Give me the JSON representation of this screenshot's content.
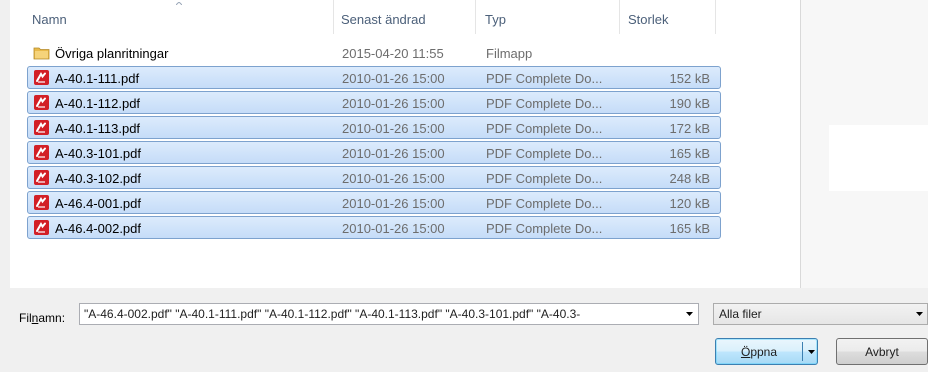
{
  "columns": {
    "name": "Namn",
    "modified": "Senast ändrad",
    "type": "Typ",
    "size": "Storlek"
  },
  "files": [
    {
      "icon": "folder-icon",
      "name": "Övriga planritningar",
      "modified": "2015-04-20 11:55",
      "type": "Filmapp",
      "size": "",
      "selected": false
    },
    {
      "icon": "pdf-icon",
      "name": "A-40.1-111.pdf",
      "modified": "2010-01-26 15:00",
      "type": "PDF Complete Do...",
      "size": "152 kB",
      "selected": true
    },
    {
      "icon": "pdf-icon",
      "name": "A-40.1-112.pdf",
      "modified": "2010-01-26 15:00",
      "type": "PDF Complete Do...",
      "size": "190 kB",
      "selected": true
    },
    {
      "icon": "pdf-icon",
      "name": "A-40.1-113.pdf",
      "modified": "2010-01-26 15:00",
      "type": "PDF Complete Do...",
      "size": "172 kB",
      "selected": true
    },
    {
      "icon": "pdf-icon",
      "name": "A-40.3-101.pdf",
      "modified": "2010-01-26 15:00",
      "type": "PDF Complete Do...",
      "size": "165 kB",
      "selected": true
    },
    {
      "icon": "pdf-icon",
      "name": "A-40.3-102.pdf",
      "modified": "2010-01-26 15:00",
      "type": "PDF Complete Do...",
      "size": "248 kB",
      "selected": true
    },
    {
      "icon": "pdf-icon",
      "name": "A-46.4-001.pdf",
      "modified": "2010-01-26 15:00",
      "type": "PDF Complete Do...",
      "size": "120 kB",
      "selected": true
    },
    {
      "icon": "pdf-icon",
      "name": "A-46.4-002.pdf",
      "modified": "2010-01-26 15:00",
      "type": "PDF Complete Do...",
      "size": "165 kB",
      "selected": true
    }
  ],
  "footer": {
    "filename_label_pre": "Fil",
    "filename_label_accel": "n",
    "filename_label_post": "amn:",
    "filename_value": "\"A-46.4-002.pdf\" \"A-40.1-111.pdf\" \"A-40.1-112.pdf\" \"A-40.1-113.pdf\" \"A-40.3-101.pdf\" \"A-40.3-",
    "filter_value": "Alla filer",
    "open_label_accel": "Ö",
    "open_label_rest": "ppna",
    "cancel_label": "Avbryt"
  },
  "colors": {
    "selection_fill": "#cfe3fb",
    "selection_border": "#7da2ce",
    "pdf_icon": "#d21f26",
    "folder_icon": "#e8b94a"
  }
}
